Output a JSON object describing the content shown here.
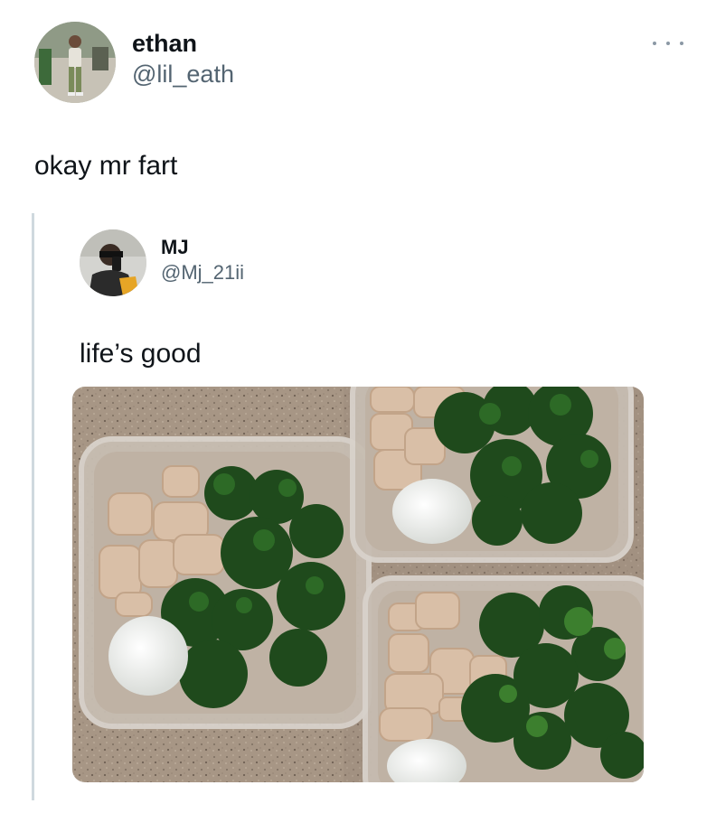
{
  "tweet": {
    "author": {
      "display_name": "ethan",
      "handle": "@lil_eath"
    },
    "text": "okay mr fart",
    "more_icon": "more-horizontal-icon"
  },
  "quoted_tweet": {
    "author": {
      "display_name": "MJ",
      "handle": "@Mj_21ii"
    },
    "text": "life’s good",
    "media": {
      "subject": "meal-prep-containers-chicken-broccoli-egg"
    }
  },
  "colors": {
    "text_primary": "#0f1419",
    "text_secondary": "#536471",
    "quote_bar": "#cfd9de",
    "countertop": "#a08f7f",
    "broccoli": "#1f4a1c"
  }
}
